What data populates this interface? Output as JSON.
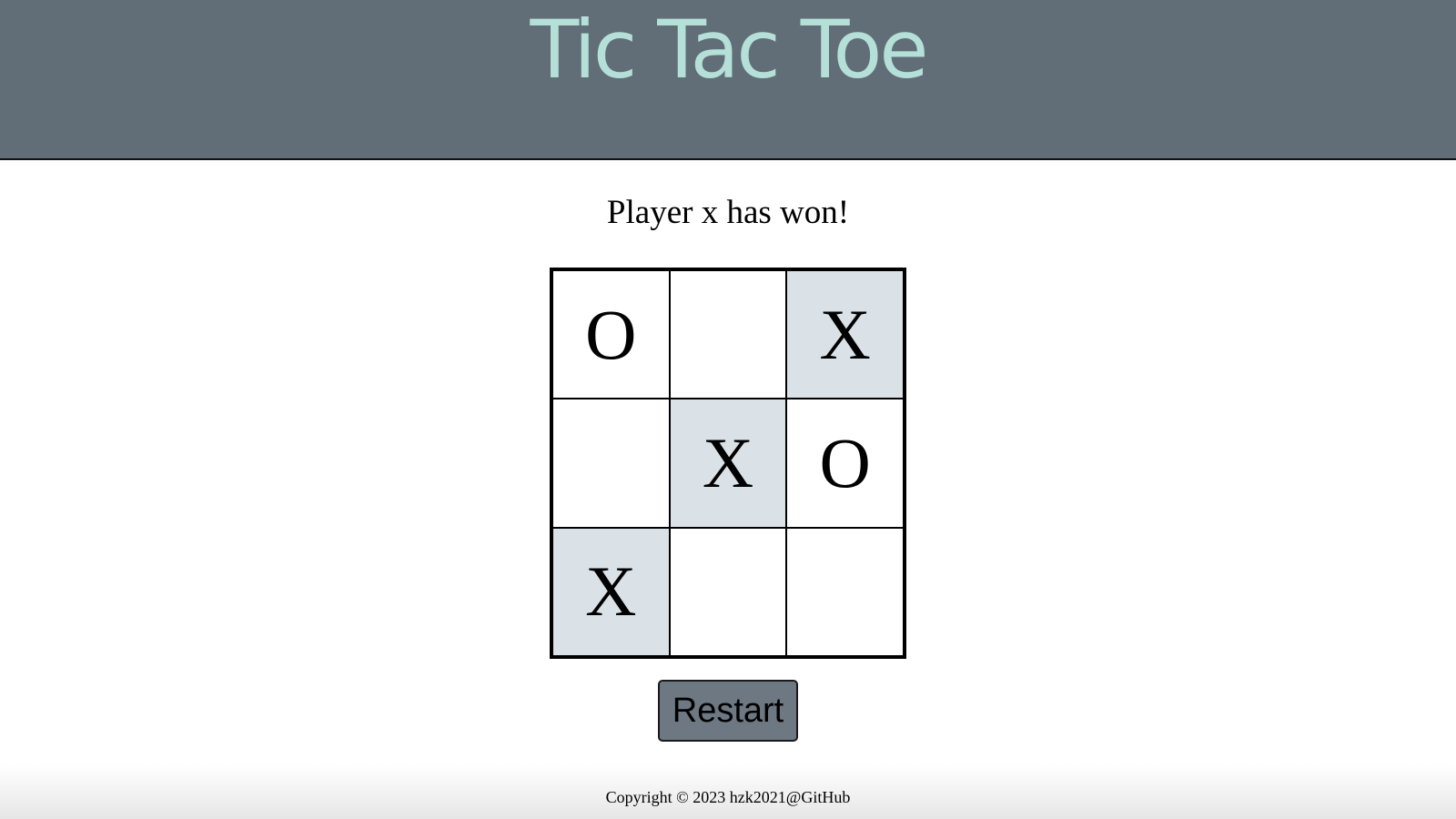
{
  "header": {
    "title": "Tic Tac Toe"
  },
  "status": "Player x has won!",
  "board": {
    "cells": [
      "O",
      "",
      "X",
      "",
      "X",
      "O",
      "X",
      "",
      ""
    ],
    "winning": [
      2,
      4,
      6
    ],
    "highlight_color": "#dae1e7"
  },
  "restart_label": "Restart",
  "footer": "Copyright © 2023 hzk2021@GitHub",
  "colors": {
    "header_bg": "#616d77",
    "title": "#b4e0d8",
    "button_bg": "#6e7882"
  }
}
